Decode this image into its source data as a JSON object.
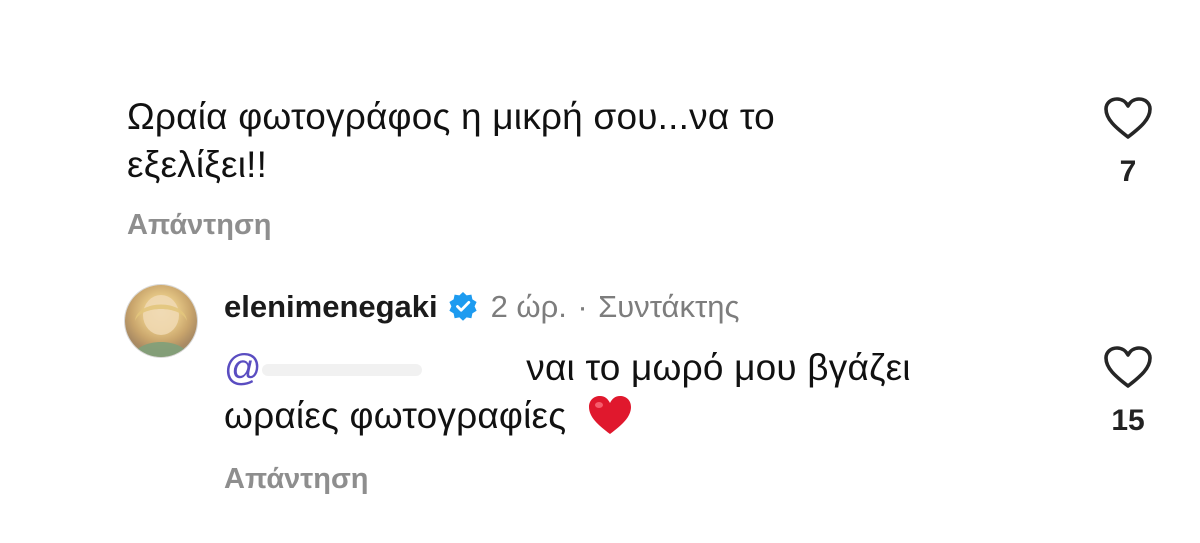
{
  "comment1": {
    "text_line1": "Ωραία φωτογράφος η μικρή σου...να το",
    "text_line2": "εξελίξει!!",
    "reply_label": "Απάντηση",
    "like_icon": "heart-outline-icon",
    "likes": "7"
  },
  "comment2": {
    "username": "elenimenegaki",
    "verified_icon": "verified-badge-icon",
    "time": "2 ώρ.",
    "separator": "·",
    "role": "Συντάκτης",
    "mention_prefix": "@",
    "text_line1": "ναι το μωρό μου βγάζει",
    "text_line2": "ωραίες φωτογραφίες",
    "emoji": "❤️",
    "reply_label": "Απάντηση",
    "like_icon": "heart-outline-icon",
    "likes": "15"
  },
  "colors": {
    "verified_blue": "#1d9bf0",
    "mention": "#5a4dc1",
    "secondary_text": "#8e8e8e",
    "heart_red": "#e0182d"
  }
}
